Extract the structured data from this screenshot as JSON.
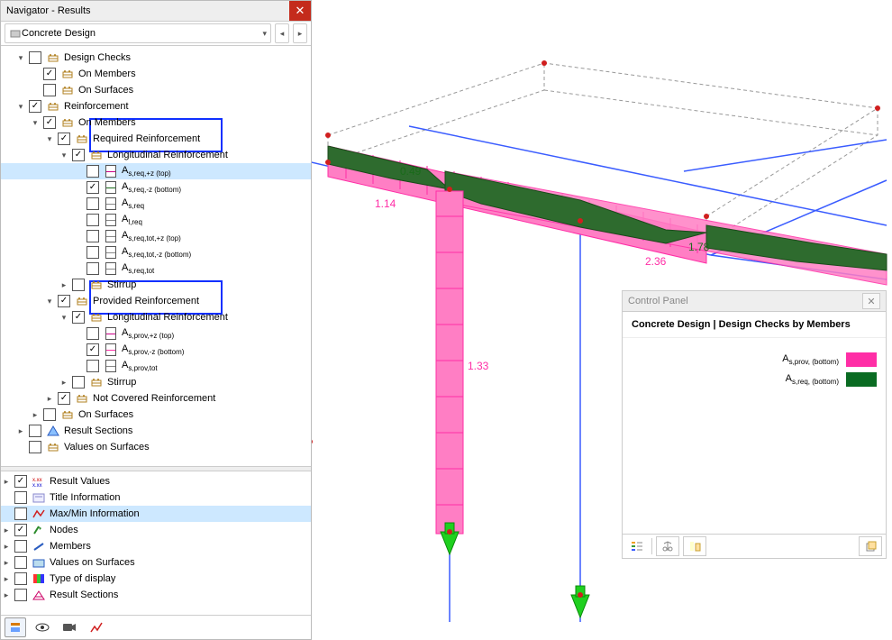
{
  "nav": {
    "title": "Navigator - Results",
    "mode": "Concrete Design",
    "tree": [
      {
        "d": 0,
        "c": "open",
        "cb": "off",
        "ic": "rebar",
        "t": "Design Checks"
      },
      {
        "d": 1,
        "c": "none",
        "cb": "on",
        "ic": "rebar",
        "t": "On Members"
      },
      {
        "d": 1,
        "c": "none",
        "cb": "off",
        "ic": "rebar",
        "t": "On Surfaces"
      },
      {
        "d": 0,
        "c": "open",
        "cb": "on",
        "ic": "rebar",
        "t": "Reinforcement"
      },
      {
        "d": 1,
        "c": "open",
        "cb": "on",
        "ic": "rebar",
        "t": "On Members"
      },
      {
        "d": 2,
        "c": "open",
        "cb": "on",
        "ic": "rebar",
        "t": "Required Reinforcement"
      },
      {
        "d": 3,
        "c": "open",
        "cb": "on",
        "ic": "rebar",
        "t": "Longitudinal Reinforcement"
      },
      {
        "d": 4,
        "c": "none",
        "cb": "off",
        "ic": "line",
        "lc": "#cc0088",
        "t": "A<sub>s,req,+z (top)</sub>",
        "sel": true
      },
      {
        "d": 4,
        "c": "none",
        "cb": "on",
        "ic": "line",
        "lc": "#1a6b1a",
        "t": "A<sub>s,req,-z (bottom)</sub>"
      },
      {
        "d": 4,
        "c": "none",
        "cb": "off",
        "ic": "line",
        "lc": "#888",
        "t": "A<sub>s,req</sub>"
      },
      {
        "d": 4,
        "c": "none",
        "cb": "off",
        "ic": "line",
        "lc": "#888",
        "t": "A<sub>l,req</sub>"
      },
      {
        "d": 4,
        "c": "none",
        "cb": "off",
        "ic": "line",
        "lc": "#888",
        "t": "A<sub>s,req,tot,+z (top)</sub>"
      },
      {
        "d": 4,
        "c": "none",
        "cb": "off",
        "ic": "line",
        "lc": "#888",
        "t": "A<sub>s,req,tot,-z (bottom)</sub>"
      },
      {
        "d": 4,
        "c": "none",
        "cb": "off",
        "ic": "line",
        "lc": "#888",
        "t": "A<sub>s,req,tot</sub>"
      },
      {
        "d": 3,
        "c": "closed",
        "cb": "off",
        "ic": "rebar",
        "t": "Stirrup"
      },
      {
        "d": 2,
        "c": "open",
        "cb": "on",
        "ic": "rebar",
        "t": "Provided Reinforcement"
      },
      {
        "d": 3,
        "c": "open",
        "cb": "on",
        "ic": "rebar",
        "t": "Longitudinal Reinforcement"
      },
      {
        "d": 4,
        "c": "none",
        "cb": "off",
        "ic": "line",
        "lc": "#cc0088",
        "t": "A<sub>s,prov,+z (top)</sub>"
      },
      {
        "d": 4,
        "c": "none",
        "cb": "on",
        "ic": "line",
        "lc": "#ff2ea6",
        "t": "A<sub>s,prov,-z (bottom)</sub>"
      },
      {
        "d": 4,
        "c": "none",
        "cb": "off",
        "ic": "line",
        "lc": "#888",
        "t": "A<sub>s,prov,tot</sub>"
      },
      {
        "d": 3,
        "c": "closed",
        "cb": "off",
        "ic": "rebar",
        "t": "Stirrup"
      },
      {
        "d": 2,
        "c": "closed",
        "cb": "on",
        "ic": "rebar",
        "t": "Not Covered Reinforcement"
      },
      {
        "d": 1,
        "c": "closed",
        "cb": "off",
        "ic": "rebar",
        "t": "On Surfaces"
      },
      {
        "d": 0,
        "c": "closed",
        "cb": "off",
        "ic": "sect",
        "t": "Result Sections"
      },
      {
        "d": 0,
        "c": "none",
        "cb": "off",
        "ic": "rebar",
        "t": "Values on Surfaces"
      }
    ],
    "tree2": [
      {
        "c": "closed",
        "cb": "on",
        "ic": "rv",
        "t": "Result Values"
      },
      {
        "c": "none",
        "cb": "off",
        "ic": "ti",
        "t": "Title Information"
      },
      {
        "c": "none",
        "cb": "off",
        "ic": "mm",
        "t": "Max/Min Information",
        "sel": true
      },
      {
        "c": "closed",
        "cb": "on",
        "ic": "nd",
        "t": "Nodes"
      },
      {
        "c": "closed",
        "cb": "off",
        "ic": "mb",
        "t": "Members"
      },
      {
        "c": "closed",
        "cb": "off",
        "ic": "vs",
        "t": "Values on Surfaces"
      },
      {
        "c": "closed",
        "cb": "off",
        "ic": "td",
        "t": "Type of display"
      },
      {
        "c": "closed",
        "cb": "off",
        "ic": "rs",
        "t": "Result Sections"
      }
    ]
  },
  "cp": {
    "title": "Control Panel",
    "subtitle": "Concrete Design | Design Checks by Members",
    "legend": [
      {
        "label": "A<sub>s,prov, (bottom)</sub>",
        "color": "#ff2ea6"
      },
      {
        "label": "A<sub>s,req, (bottom)</sub>",
        "color": "#0a6b22"
      }
    ]
  },
  "vp": {
    "vals": {
      "a": "0.49",
      "b": "1.14",
      "c": "1.33",
      "d": "1.78",
      "e": "2.36"
    }
  }
}
